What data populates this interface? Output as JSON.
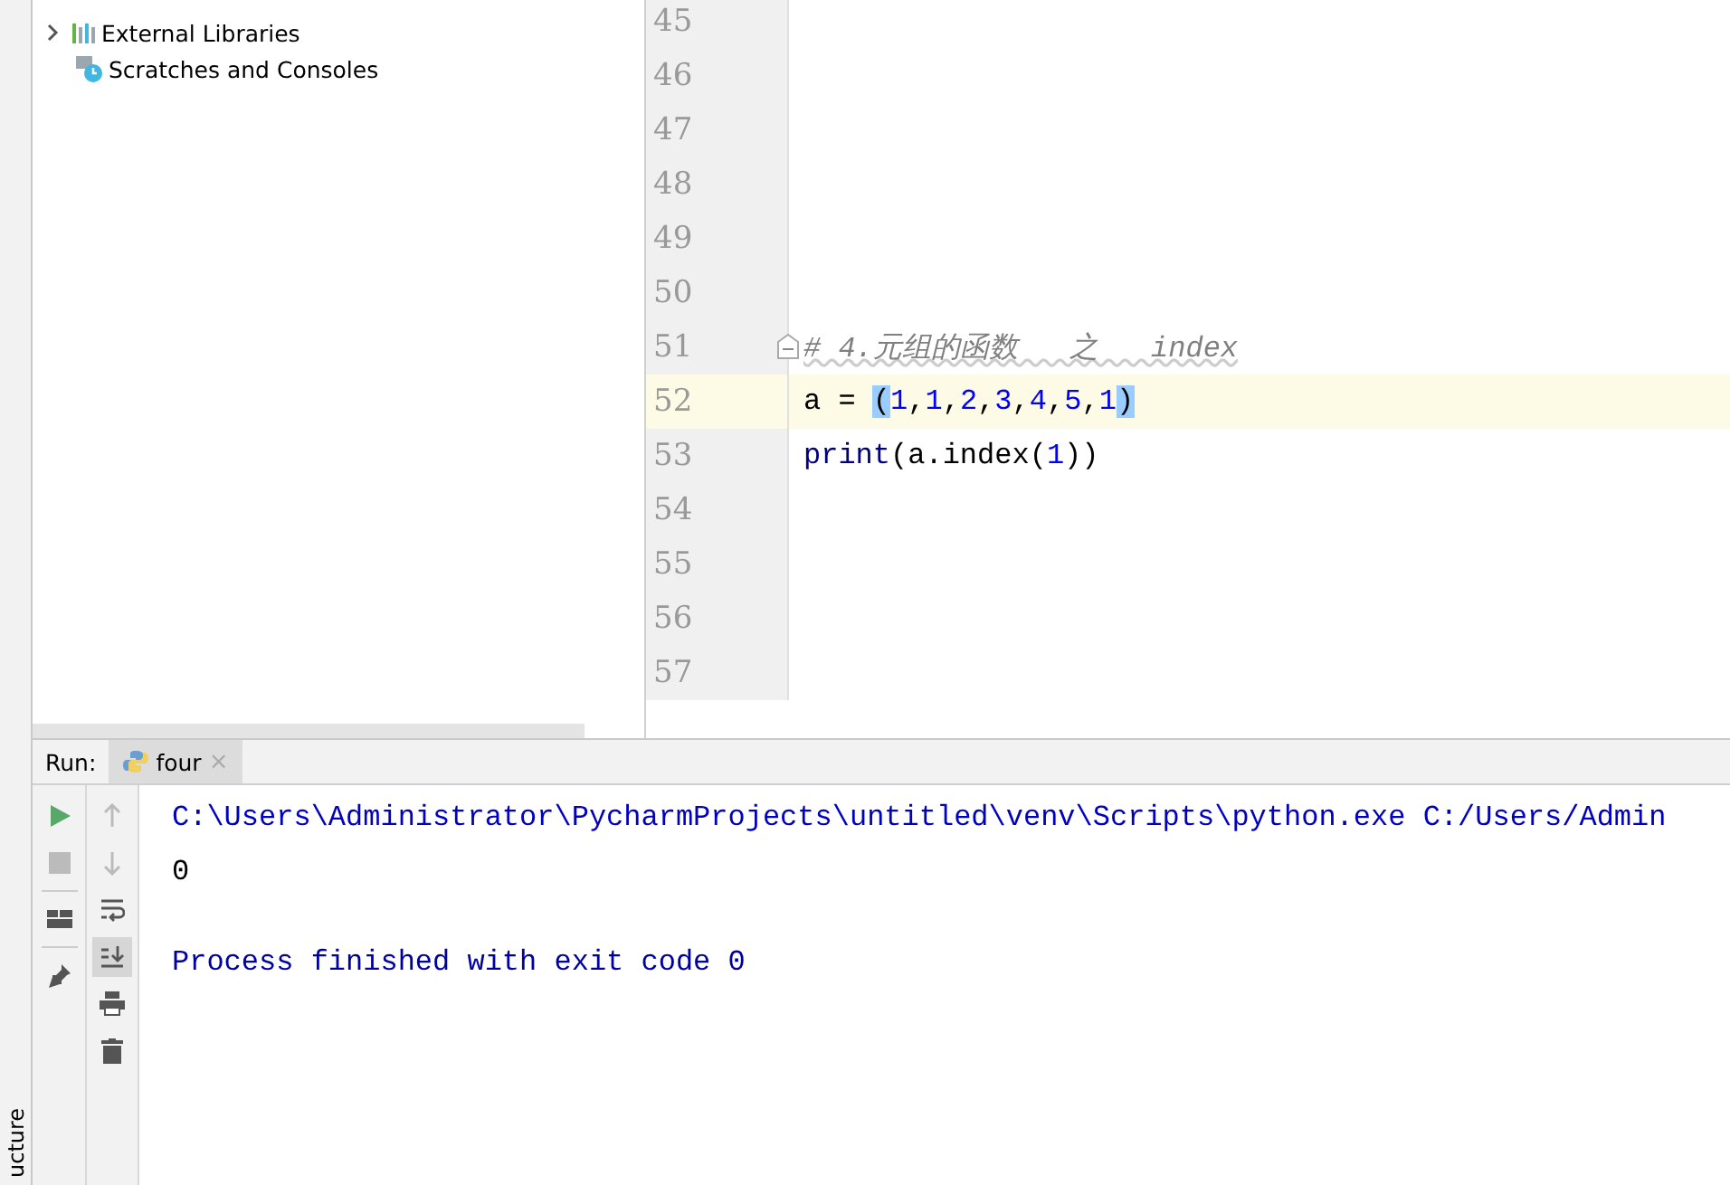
{
  "side_strip": {
    "label": "ucture"
  },
  "project_tree": {
    "items": [
      {
        "kind": "libraries",
        "label": "External Libraries"
      },
      {
        "kind": "scratches",
        "label": "Scratches and Consoles"
      }
    ]
  },
  "editor": {
    "lines": [
      {
        "number": "45",
        "current": false
      },
      {
        "number": "46",
        "current": false
      },
      {
        "number": "47",
        "current": false
      },
      {
        "number": "48",
        "current": false
      },
      {
        "number": "49",
        "current": false
      },
      {
        "number": "50",
        "current": false
      },
      {
        "number": "51",
        "current": false,
        "fold": true,
        "tokens": [
          {
            "kind": "comment",
            "text": "# 4.元组的函数   之   index"
          }
        ]
      },
      {
        "number": "52",
        "current": true,
        "tokens": [
          {
            "kind": "plain",
            "text": "a = "
          },
          {
            "kind": "brace",
            "text": "("
          },
          {
            "kind": "number",
            "text": "1"
          },
          {
            "kind": "plain",
            "text": ","
          },
          {
            "kind": "number",
            "text": "1"
          },
          {
            "kind": "plain",
            "text": ","
          },
          {
            "kind": "number",
            "text": "2"
          },
          {
            "kind": "plain",
            "text": ","
          },
          {
            "kind": "number",
            "text": "3"
          },
          {
            "kind": "plain",
            "text": ","
          },
          {
            "kind": "number",
            "text": "4"
          },
          {
            "kind": "plain",
            "text": ","
          },
          {
            "kind": "number",
            "text": "5"
          },
          {
            "kind": "plain",
            "text": ","
          },
          {
            "kind": "number",
            "text": "1"
          },
          {
            "kind": "brace",
            "text": ")"
          }
        ]
      },
      {
        "number": "53",
        "current": false,
        "tokens": [
          {
            "kind": "builtin",
            "text": "print"
          },
          {
            "kind": "plain",
            "text": "(a.index("
          },
          {
            "kind": "number",
            "text": "1"
          },
          {
            "kind": "plain",
            "text": "))"
          }
        ]
      },
      {
        "number": "54",
        "current": false
      },
      {
        "number": "55",
        "current": false
      },
      {
        "number": "56",
        "current": false
      },
      {
        "number": "57",
        "current": false
      }
    ]
  },
  "run_panel": {
    "label": "Run:",
    "tabs": [
      {
        "label": "four",
        "selected": true,
        "close": "×"
      }
    ],
    "toolbar_left": [
      {
        "kind": "run",
        "disabled": false
      },
      {
        "kind": "stop",
        "disabled": true
      },
      {
        "kind": "layout",
        "disabled": false
      },
      {
        "kind": "pin",
        "disabled": false
      }
    ],
    "toolbar_right": [
      {
        "kind": "up",
        "disabled": true,
        "toggled": false
      },
      {
        "kind": "down",
        "disabled": true,
        "toggled": false
      },
      {
        "kind": "wrap",
        "disabled": false,
        "toggled": false
      },
      {
        "kind": "scroll-end",
        "disabled": false,
        "toggled": true
      },
      {
        "kind": "print",
        "disabled": false,
        "toggled": false
      },
      {
        "kind": "trash",
        "disabled": false,
        "toggled": false
      }
    ],
    "console": [
      {
        "kind": "command",
        "text": "C:\\Users\\Administrator\\PycharmProjects\\untitled\\venv\\Scripts\\python.exe C:/Users/Admin"
      },
      {
        "kind": "output",
        "text": "0"
      },
      {
        "kind": "system",
        "text": "Process finished with exit code 0"
      }
    ]
  }
}
